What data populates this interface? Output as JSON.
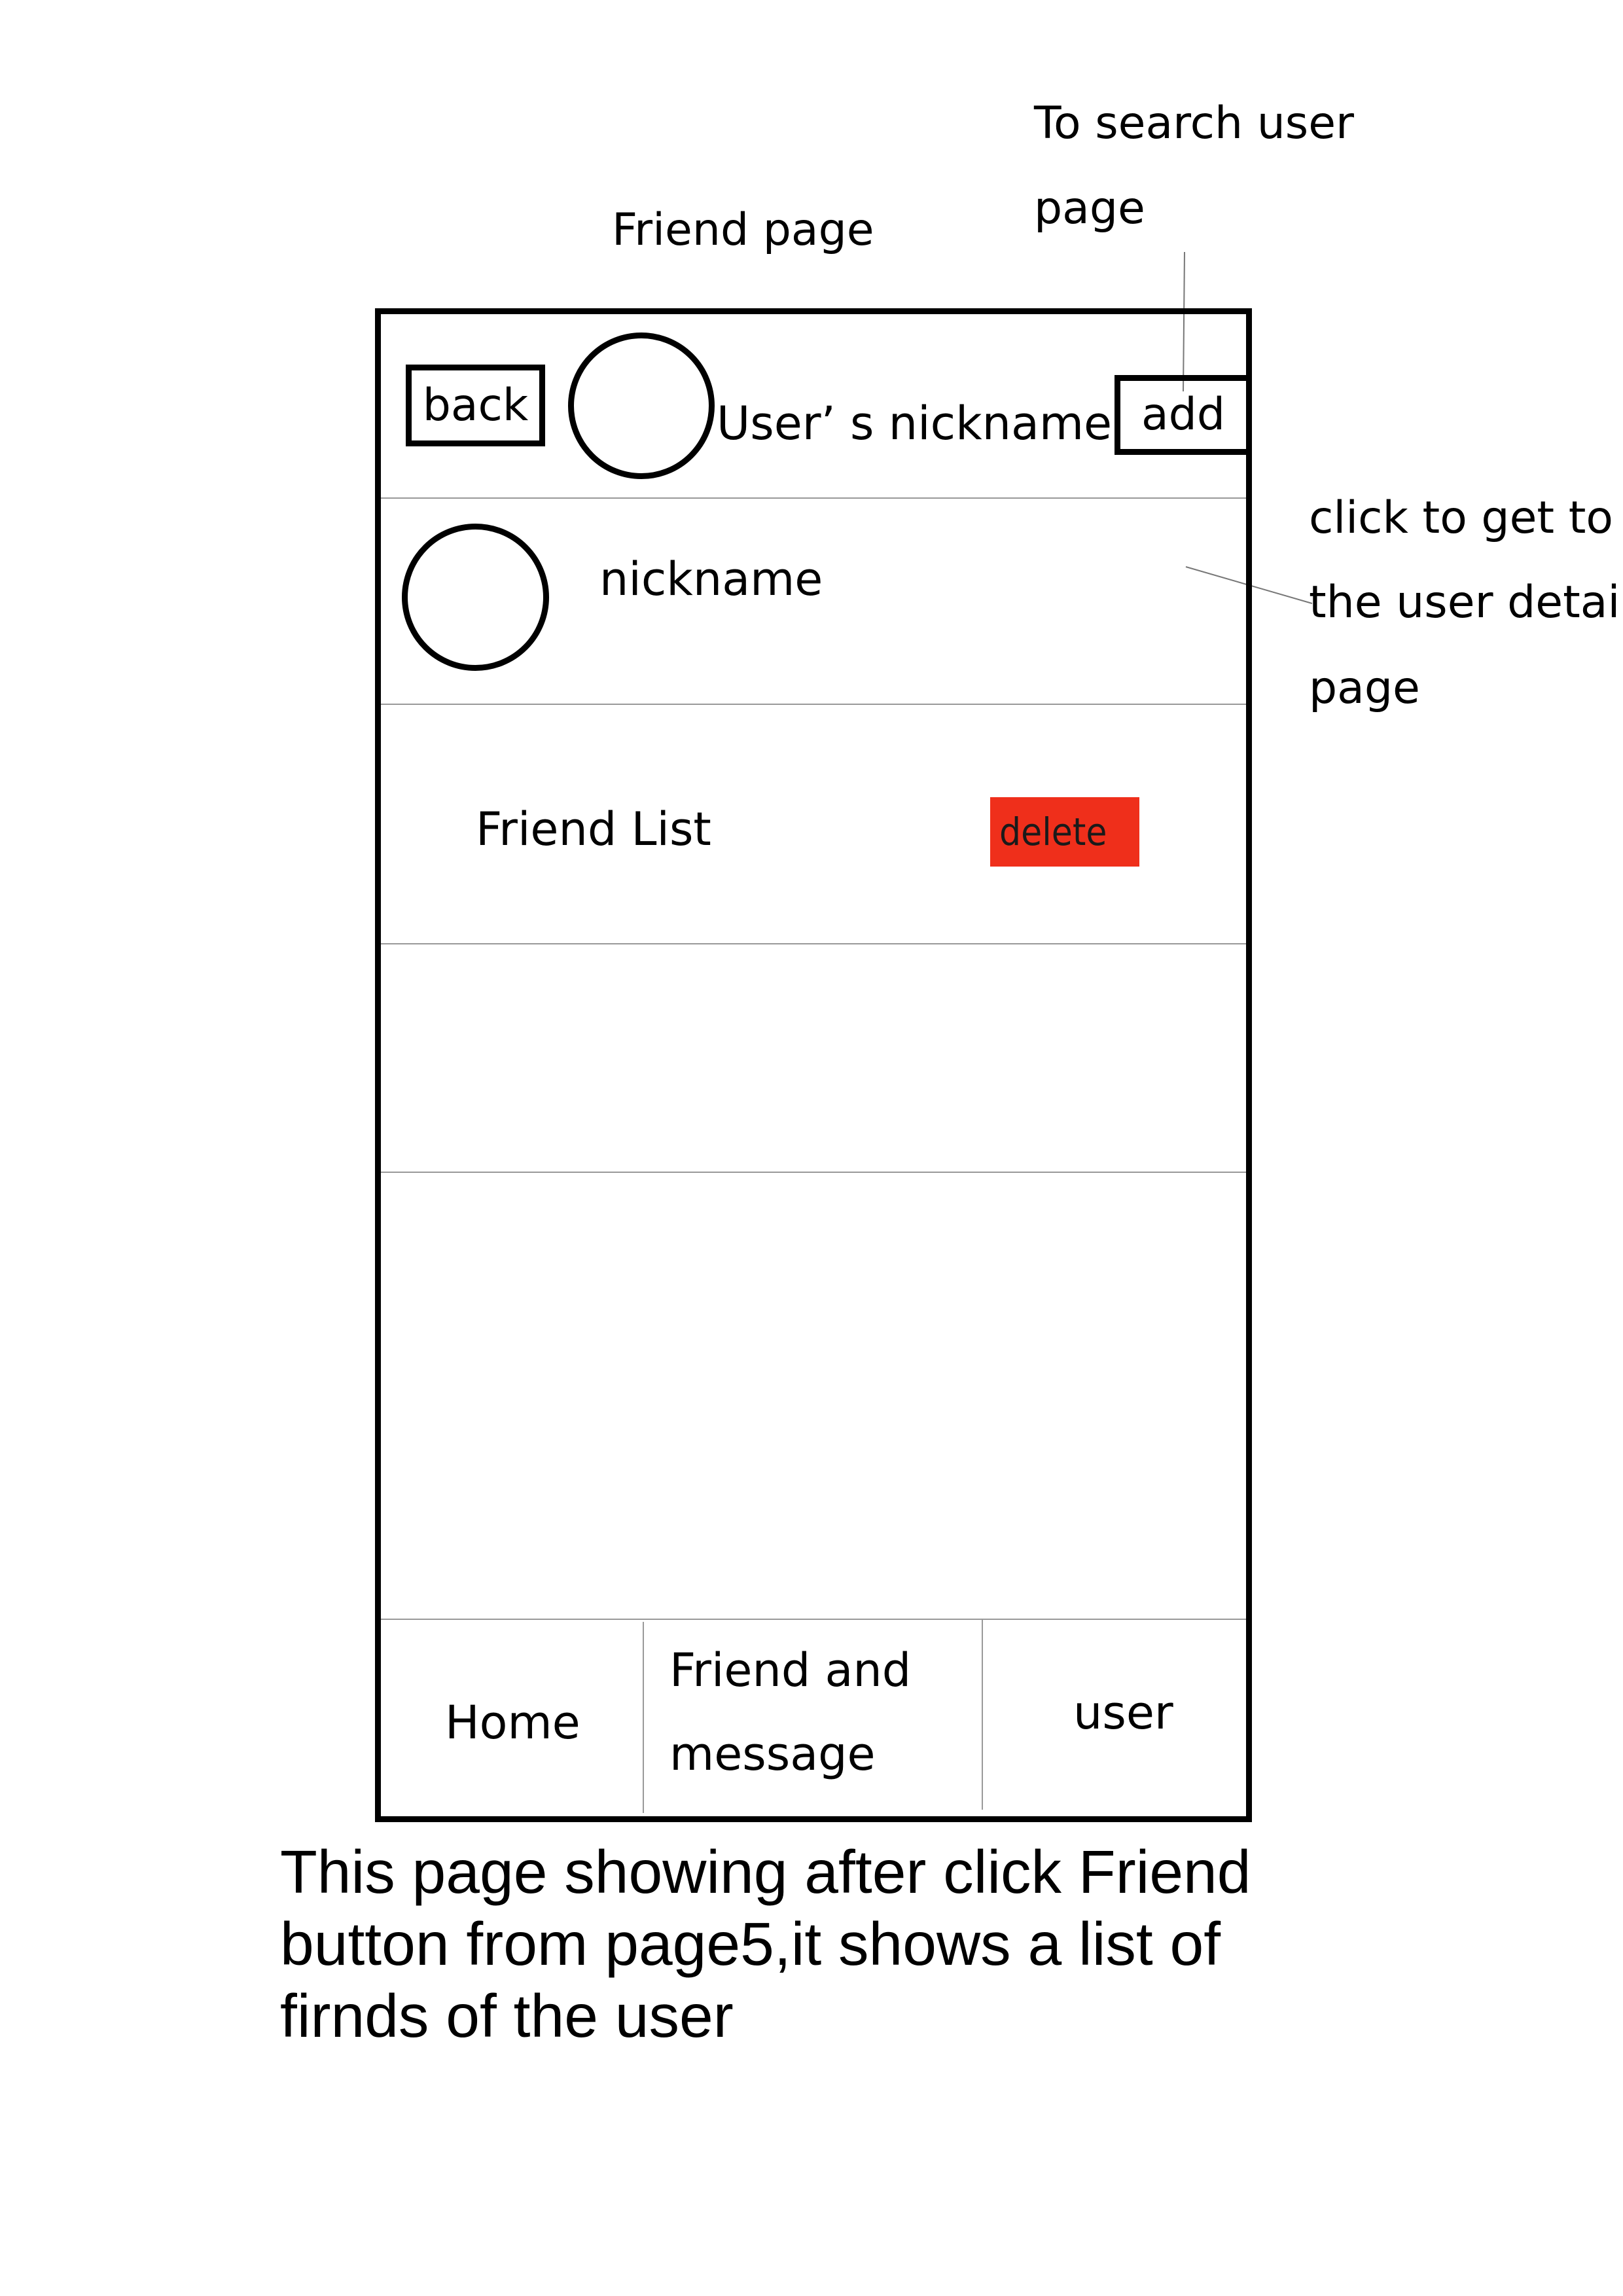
{
  "annotations": {
    "page_title": "Friend page",
    "add_note": [
      "To search user",
      "page"
    ],
    "detail_note": [
      "click to get to",
      "the user detail",
      "page"
    ]
  },
  "header": {
    "back_label": "back",
    "user_nickname": "User’ s nickname",
    "add_label": "add"
  },
  "profile": {
    "nickname": "nickname"
  },
  "friend_list": {
    "label": "Friend List",
    "delete_label": "delete",
    "delete_color": "#ef2f1b"
  },
  "bottom_nav": {
    "home": "Home",
    "friend_message": [
      "Friend and",
      "message"
    ],
    "user": "user"
  },
  "caption": [
    "This page showing after click Friend",
    "button from page5,it shows a list of",
    "firnds of the user"
  ]
}
